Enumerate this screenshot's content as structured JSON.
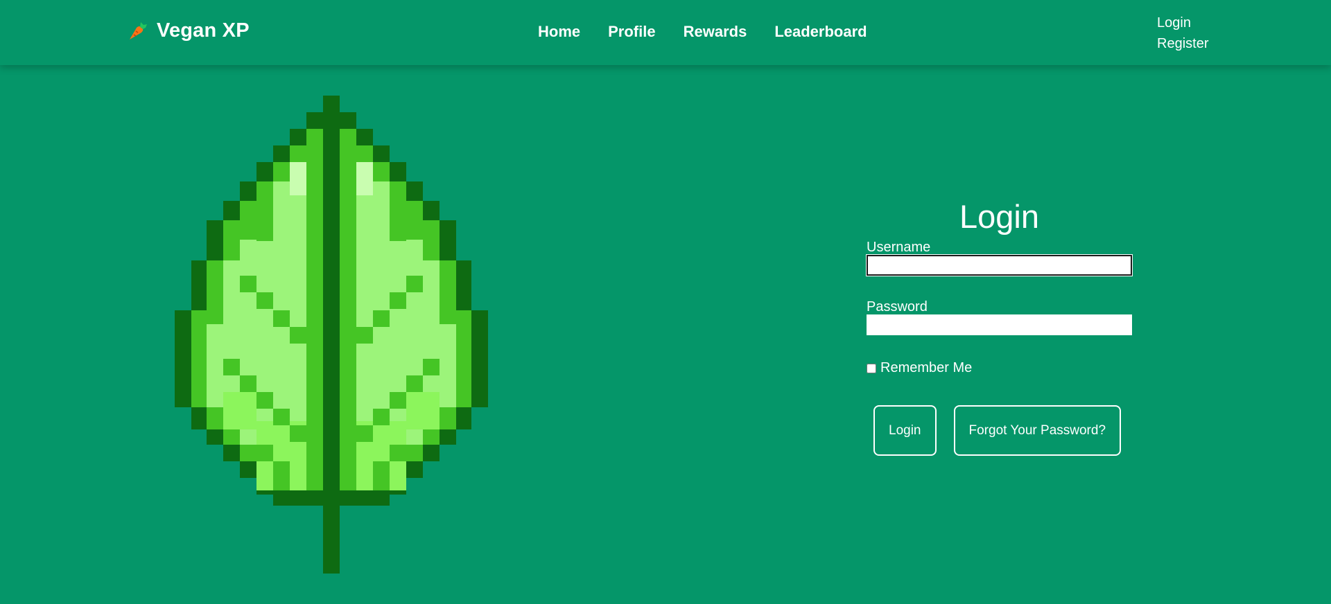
{
  "brand": {
    "name": "Vegan XP",
    "logo_icon": "carrot-icon"
  },
  "nav": {
    "items": [
      {
        "label": "Home"
      },
      {
        "label": "Profile"
      },
      {
        "label": "Rewards"
      },
      {
        "label": "Leaderboard"
      }
    ]
  },
  "auth": {
    "login_label": "Login",
    "register_label": "Register"
  },
  "hero": {
    "illustration": "pixel-leaf-icon"
  },
  "login_form": {
    "title": "Login",
    "username_label": "Username",
    "username_value": "",
    "password_label": "Password",
    "password_value": "",
    "remember_label": "Remember Me",
    "remember_checked": false,
    "submit_label": "Login",
    "forgot_label": "Forgot Your Password?"
  },
  "colors": {
    "background": "#059669",
    "text": "#ffffff",
    "leaf_outline": "#0e6b12",
    "leaf_midrib": "#0e6b12",
    "leaf_mid": "#45c525",
    "leaf_light": "#9cf47a",
    "leaf_bright": "#8cf55c",
    "leaf_highlight": "#c9fdb0"
  }
}
